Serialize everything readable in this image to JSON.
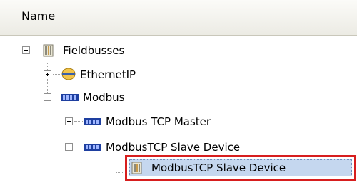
{
  "header": {
    "column_label": "Name"
  },
  "tree": {
    "fieldbusses": "Fieldbusses",
    "ethernetip": "EthernetIP",
    "modbus": "Modbus",
    "modbus_tcp_master": "Modbus TCP Master",
    "modbustcp_slave_device_group": "ModbusTCP Slave Device",
    "modbustcp_slave_device_item": "ModbusTCP Slave Device"
  },
  "icons": {
    "fieldbusses": "device-rack-icon",
    "ethernetip": "ethernetip-icon",
    "modbus": "modbus-icon",
    "modbus_tcp_master": "modbus-icon",
    "modbustcp_slave_device_group": "modbus-icon",
    "modbustcp_slave_device_item": "device-rack-icon"
  },
  "colors": {
    "selection_background": "#c5d7ef",
    "highlight_border": "#d71e1e",
    "header_bg": "#ecebe4"
  }
}
